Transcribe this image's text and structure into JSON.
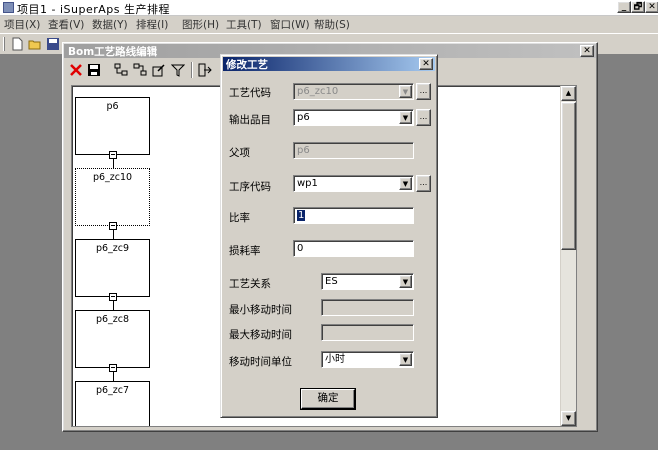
{
  "app": {
    "title": "项目1 - iSuperAps 生产排程",
    "window_buttons": [
      "_",
      "🗗",
      "✕"
    ]
  },
  "menu": [
    {
      "label": "项目(X)"
    },
    {
      "label": "查看(V)"
    },
    {
      "label": "数据(Y)"
    },
    {
      "label": "排程(I)"
    },
    {
      "label": "图形(H)"
    },
    {
      "label": "工具(T)"
    },
    {
      "label": "窗口(W)"
    },
    {
      "label": "帮助(S)"
    }
  ],
  "bom_window": {
    "title": "Bom工艺路线编辑",
    "close_label": "✕",
    "toolbar_icons": [
      "delete-icon",
      "save-icon",
      "expand-icon",
      "collapse-icon",
      "edit-icon",
      "filter-icon",
      "exit-icon"
    ]
  },
  "process_nodes": [
    {
      "label": "p6",
      "selected": false
    },
    {
      "label": "p6_zc10",
      "selected": true
    },
    {
      "label": "p6_zc9",
      "selected": false
    },
    {
      "label": "p6_zc8",
      "selected": false
    },
    {
      "label": "p6_zc7",
      "selected": false
    }
  ],
  "dialog": {
    "title": "修改工艺",
    "close_label": "✕",
    "fields": {
      "process_code": {
        "label": "工艺代码",
        "value": "p6_zc10"
      },
      "output_item": {
        "label": "输出品目",
        "value": "p6"
      },
      "parent": {
        "label": "父项",
        "value": "p6"
      },
      "operation_code": {
        "label": "工序代码",
        "value": "wp1"
      },
      "ratio": {
        "label": "比率",
        "value": "1"
      },
      "loss_rate": {
        "label": "损耗率",
        "value": "0"
      },
      "relation": {
        "label": "工艺关系",
        "value": "ES"
      },
      "min_move": {
        "label": "最小移动时间",
        "value": ""
      },
      "max_move": {
        "label": "最大移动时间",
        "value": ""
      },
      "move_unit": {
        "label": "移动时间单位",
        "value": "小时"
      }
    },
    "ok_label": "确定",
    "ellipsis": "..."
  },
  "colors": {
    "face": "#d4d0c8",
    "dialog_title": "#0a246a",
    "inactive_title": "#9f9f9f",
    "workspace": "#808080"
  }
}
